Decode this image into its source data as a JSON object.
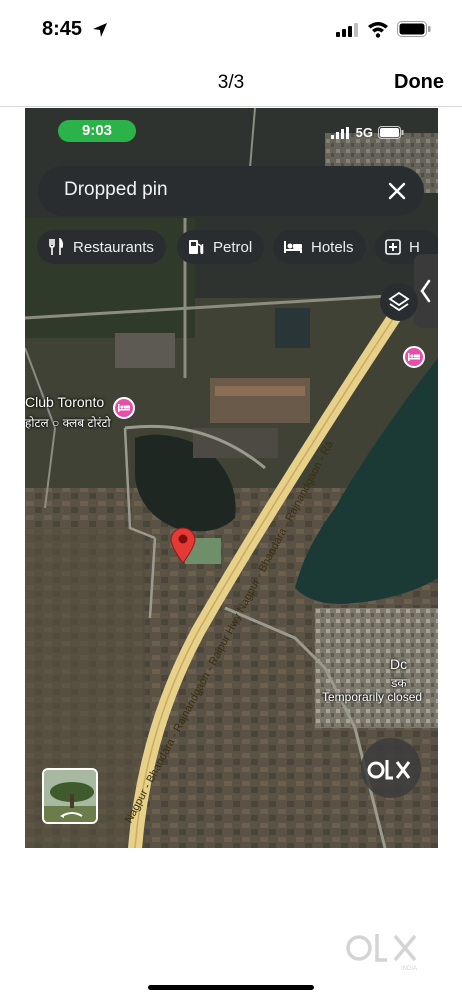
{
  "status_bar": {
    "time": "8:45"
  },
  "nav": {
    "counter": "3/3",
    "done_label": "Done"
  },
  "inner": {
    "time": "9:03",
    "network": "5G",
    "search": {
      "query": "Dropped pin"
    },
    "chips": [
      {
        "label": "Restaurants",
        "icon": "fork-knife-icon"
      },
      {
        "label": "Petrol",
        "icon": "fuel-pump-icon"
      },
      {
        "label": "Hotels",
        "icon": "bed-icon"
      },
      {
        "label": "H",
        "icon": "hospital-icon"
      }
    ],
    "places": {
      "club_name": "Club Toronto",
      "club_local": "होटल ○ क्लब टोरंटो",
      "dc_name": "Dc",
      "dc_local": "डक",
      "dc_status": "Temporarily closed"
    },
    "road_name": "Nagpur - Bhandara - Rajnandgaon - Raipur Hwy Nagpur - Bhandara - Rajnandgaon - Ra"
  },
  "watermark": {
    "text": "OLX",
    "sub": "INDIA"
  },
  "colors": {
    "accent_red": "#e53935",
    "poi_pink": "#e64fa8",
    "chip_bg": "#2a2d30",
    "time_pill": "#2bb34a"
  }
}
